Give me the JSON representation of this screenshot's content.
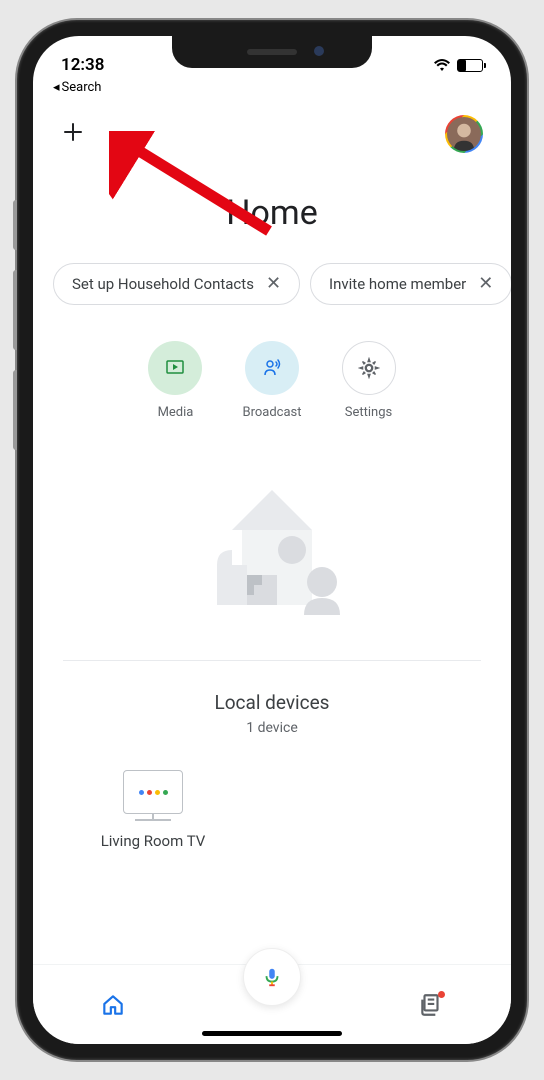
{
  "status": {
    "time": "12:38"
  },
  "back": {
    "label": "Search"
  },
  "header": {
    "title": "Home"
  },
  "chips": [
    {
      "label": "Set up Household Contacts",
      "dismissible": true
    },
    {
      "label": "Invite home member",
      "dismissible": true
    }
  ],
  "actions": {
    "media": {
      "label": "Media"
    },
    "broadcast": {
      "label": "Broadcast"
    },
    "settings": {
      "label": "Settings"
    }
  },
  "local": {
    "title": "Local devices",
    "count_label": "1 device",
    "devices": [
      {
        "name": "Living Room TV"
      }
    ]
  },
  "colors": {
    "google_blue": "#4285f4",
    "google_red": "#ea4335",
    "google_yellow": "#fbbc04",
    "google_green": "#34a853",
    "annotation_red": "#e30613"
  }
}
